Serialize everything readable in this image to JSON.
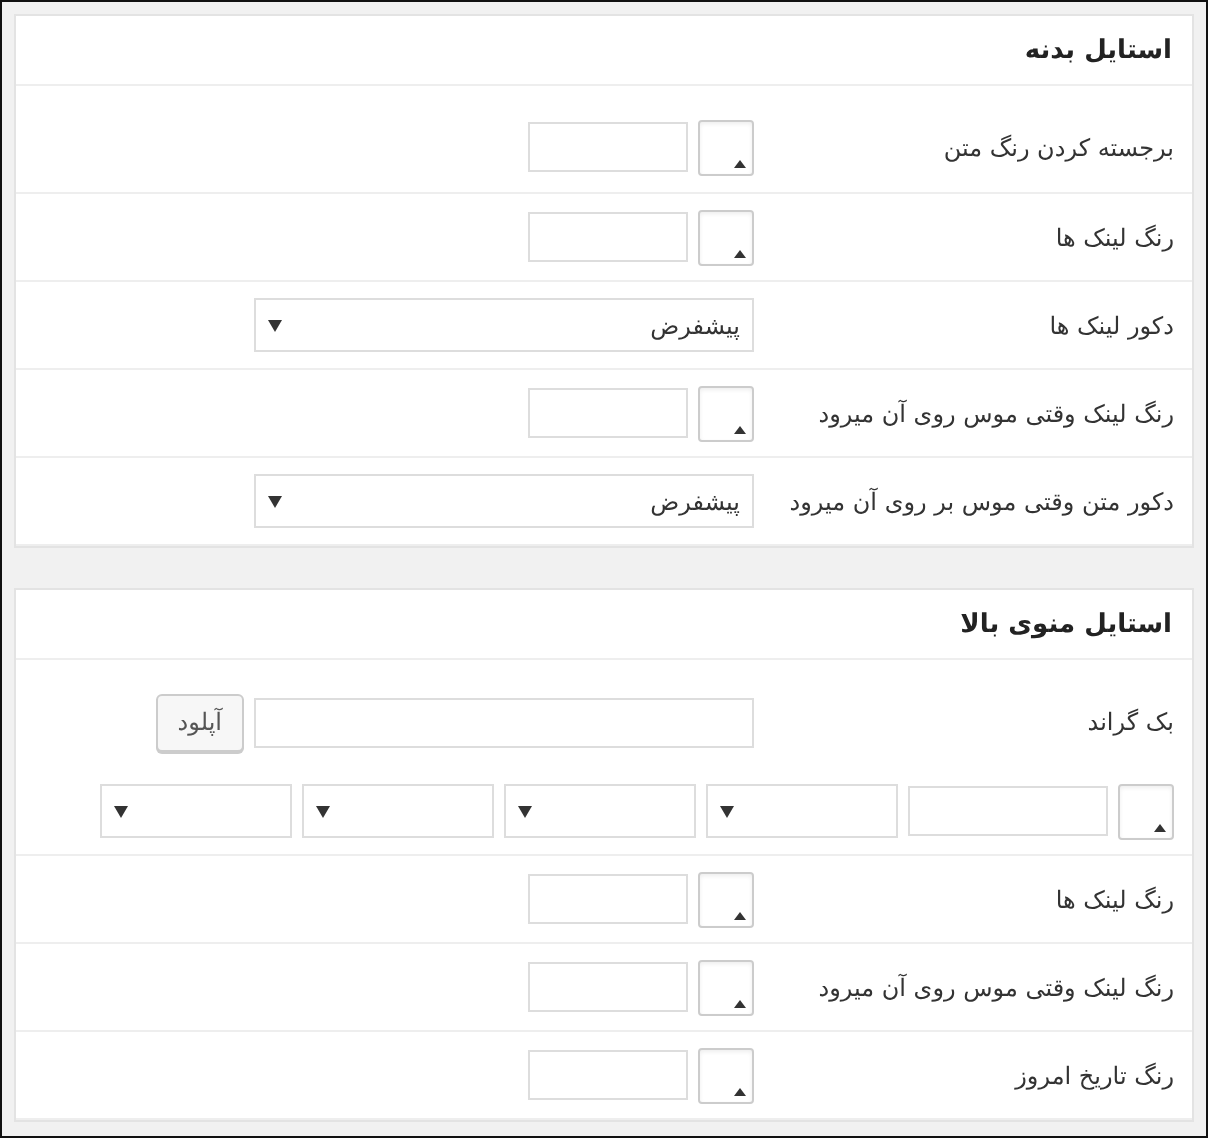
{
  "sections": [
    {
      "title": "استایل بدنه",
      "rows": [
        {
          "kind": "color",
          "label": "برجسته کردن رنگ متن"
        },
        {
          "kind": "color",
          "label": "رنگ لینک ها"
        },
        {
          "kind": "select",
          "label": "دکور لینک ها",
          "value": "پیشفرض"
        },
        {
          "kind": "color",
          "label": "رنگ لینک وقتی موس روی آن میرود"
        },
        {
          "kind": "select",
          "label": "دکور متن وقتی موس بر روی آن میرود",
          "value": "پیشفرض"
        }
      ]
    },
    {
      "title": "استایل منوی بالا",
      "rows": [
        {
          "kind": "upload",
          "label": "بک گراند",
          "button": "آپلود"
        },
        {
          "kind": "font",
          "parts": [
            {
              "kind": "color"
            },
            {
              "kind": "text"
            },
            {
              "kind": "select"
            },
            {
              "kind": "select"
            },
            {
              "kind": "select"
            },
            {
              "kind": "select"
            }
          ]
        },
        {
          "kind": "color",
          "label": "رنگ لینک ها"
        },
        {
          "kind": "color",
          "label": "رنگ لینک وقتی موس روی آن میرود"
        },
        {
          "kind": "color",
          "label": "رنگ تاریخ امروز"
        }
      ]
    }
  ]
}
